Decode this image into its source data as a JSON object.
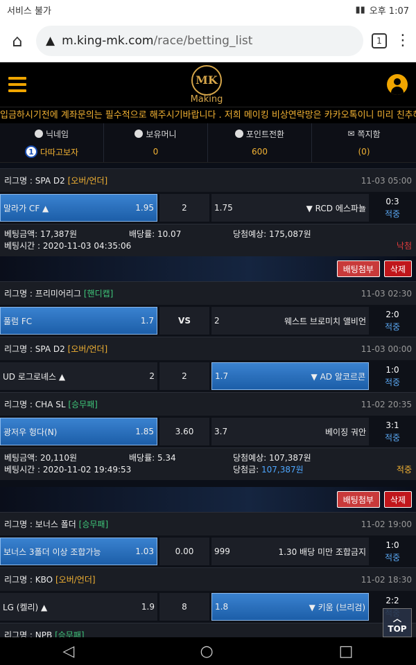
{
  "status": {
    "carrier": "서비스 불가",
    "time": "오후 1:07"
  },
  "browser": {
    "domain": "m.king-mk.com",
    "path": "/race/betting_list",
    "tabs_count": "1"
  },
  "site": {
    "logo_mark": "MK",
    "logo_text": "Making",
    "marquee": "입금하시기전에 계좌문의는 필수적으로 해주시기바랍니다 . 저희 메이킹 비상연락망은 카카오톡이니 미리 친추해주시기"
  },
  "info": {
    "nickname_label": "닉네임",
    "nickname_value": "다따고보자",
    "level": "1",
    "money_label": "보유머니",
    "money_value": "0",
    "point_label": "포인트전환",
    "point_value": "600",
    "memo_label": "쪽지함",
    "memo_value": "(0)"
  },
  "bets": [
    {
      "matches": [
        {
          "league": "리그명 : SPA D2",
          "type": "[오버/언더]",
          "time": "11-03 05:00",
          "home": "말라가 CF ▲",
          "home_odds": "1.95",
          "draw": "2",
          "away_odds": "1.75",
          "away": "▼ RCD 에스파뇰",
          "score": "0:3",
          "status": "적중"
        }
      ],
      "summary": {
        "bet_amount": "베팅금액: 17,387원",
        "odds": "배당률: 10.07",
        "expected": "당첨예상: 175,087원",
        "bet_time": "베팅시간 : 2020-11-03 04:35:06",
        "result": "낙첨"
      }
    },
    {
      "actions": {
        "attach": "배팅첨부",
        "delete": "삭제"
      },
      "matches": [
        {
          "league": "리그명 : 프리미어리그",
          "type": "[핸디캡]",
          "time": "11-03 02:30",
          "home": "풀럼 FC",
          "home_odds": "1.7",
          "draw": "VS",
          "away_odds": "2",
          "away": "웨스트 브로미치 앨비언",
          "score": "2:0",
          "status": "적중"
        },
        {
          "league": "리그명 : SPA D2",
          "type": "[오버/언더]",
          "time": "11-03 00:00",
          "home": "UD 로그로녜스 ▲",
          "home_odds": "2",
          "draw": "2",
          "away_odds": "1.7",
          "away": "▼ AD 알코르콘",
          "score": "1:0",
          "status": "적중"
        },
        {
          "league": "리그명 : CHA SL",
          "type": "[승무패]",
          "time": "11-02 20:35",
          "home": "광저우 헝다(N)",
          "home_odds": "1.85",
          "draw": "3.60",
          "away_odds": "3.7",
          "away": "베이징 궈안",
          "score": "3:1",
          "status": "적중"
        }
      ],
      "summary": {
        "bet_amount": "베팅금액: 20,110원",
        "odds": "배당률: 5.34",
        "expected": "당첨예상: 107,387원",
        "bet_time": "베팅시간 : 2020-11-02 19:49:53",
        "win_label": "당첨금:",
        "win_amount": "107,387원",
        "result": "적중"
      }
    },
    {
      "actions": {
        "attach": "배팅첨부",
        "delete": "삭제"
      },
      "matches": [
        {
          "league": "리그명 : 보너스 폴더",
          "type": "[승무패]",
          "time": "11-02 19:00",
          "home": "보너스 3폴더 이상 조합가능",
          "home_odds": "1.03",
          "draw": "0.00",
          "away_odds": "999",
          "away": "1.30 배당 미만 조합금지",
          "score": "1:0",
          "status": "적중"
        },
        {
          "league": "리그명 : KBO",
          "type": "[오버/언더]",
          "time": "11-02 18:30",
          "home": "LG (켈리) ▲",
          "home_odds": "1.9",
          "draw": "8",
          "away_odds": "1.8",
          "away": "▼ 키움 (브리검)",
          "score": "2:2",
          "status": "적중"
        }
      ]
    }
  ],
  "partial_league": {
    "league": "리그명 : NPB",
    "type": "[승무패]"
  },
  "top_label": "TOP",
  "nav": {
    "back": "◁",
    "home": "○",
    "recent": "□"
  }
}
